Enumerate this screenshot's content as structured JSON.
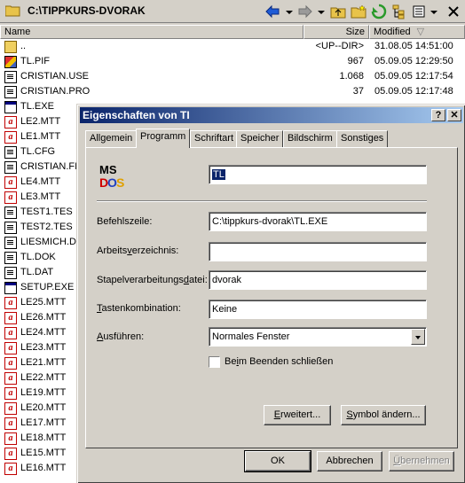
{
  "fm": {
    "path": "C:\\TIPPKURS-DVORAK",
    "columns": {
      "name": "Name",
      "size": "Size",
      "modified": "Modified",
      "sort_glyph": "▽"
    },
    "rows": [
      {
        "name": "..",
        "size": "<UP--DIR>",
        "modified": "31.08.05 14:51:00",
        "icon": "up"
      },
      {
        "name": "TL.PIF",
        "size": "967",
        "modified": "05.09.05 12:29:50",
        "icon": "pif"
      },
      {
        "name": "CRISTIAN.USE",
        "size": "1.068",
        "modified": "05.09.05 12:17:54",
        "icon": "doc"
      },
      {
        "name": "CRISTIAN.PRO",
        "size": "37",
        "modified": "05.09.05 12:17:48",
        "icon": "doc"
      },
      {
        "name": "TL.EXE",
        "size": "",
        "modified": "",
        "icon": "exe"
      },
      {
        "name": "LE2.MTT",
        "size": "",
        "modified": "",
        "icon": "pdf"
      },
      {
        "name": "LE1.MTT",
        "size": "",
        "modified": "",
        "icon": "pdf"
      },
      {
        "name": "TL.CFG",
        "size": "",
        "modified": "",
        "icon": "doc"
      },
      {
        "name": "CRISTIAN.FI",
        "size": "",
        "modified": "",
        "icon": "doc"
      },
      {
        "name": "LE4.MTT",
        "size": "",
        "modified": "",
        "icon": "pdf"
      },
      {
        "name": "LE3.MTT",
        "size": "",
        "modified": "",
        "icon": "pdf"
      },
      {
        "name": "TEST1.TES",
        "size": "",
        "modified": "",
        "icon": "doc"
      },
      {
        "name": "TEST2.TES",
        "size": "",
        "modified": "",
        "icon": "doc"
      },
      {
        "name": "LIESMICH.D",
        "size": "",
        "modified": "",
        "icon": "doc"
      },
      {
        "name": "TL.DOK",
        "size": "",
        "modified": "",
        "icon": "doc"
      },
      {
        "name": "TL.DAT",
        "size": "",
        "modified": "",
        "icon": "doc"
      },
      {
        "name": "SETUP.EXE",
        "size": "",
        "modified": "",
        "icon": "exe"
      },
      {
        "name": "LE25.MTT",
        "size": "",
        "modified": "",
        "icon": "pdf"
      },
      {
        "name": "LE26.MTT",
        "size": "",
        "modified": "",
        "icon": "pdf"
      },
      {
        "name": "LE24.MTT",
        "size": "",
        "modified": "",
        "icon": "pdf"
      },
      {
        "name": "LE23.MTT",
        "size": "",
        "modified": "",
        "icon": "pdf"
      },
      {
        "name": "LE21.MTT",
        "size": "",
        "modified": "",
        "icon": "pdf"
      },
      {
        "name": "LE22.MTT",
        "size": "",
        "modified": "",
        "icon": "pdf"
      },
      {
        "name": "LE19.MTT",
        "size": "",
        "modified": "",
        "icon": "pdf"
      },
      {
        "name": "LE20.MTT",
        "size": "",
        "modified": "",
        "icon": "pdf"
      },
      {
        "name": "LE17.MTT",
        "size": "",
        "modified": "",
        "icon": "pdf"
      },
      {
        "name": "LE18.MTT",
        "size": "",
        "modified": "",
        "icon": "pdf"
      },
      {
        "name": "LE15.MTT",
        "size": "",
        "modified": "",
        "icon": "pdf"
      },
      {
        "name": "LE16.MTT",
        "size": "",
        "modified": "",
        "icon": "pdf"
      }
    ]
  },
  "dialog": {
    "title": "Eigenschaften von TI",
    "help_glyph": "?",
    "close_glyph": "✕",
    "tabs": [
      "Allgemein",
      "Programm",
      "Schriftart",
      "Speicher",
      "Bildschirm",
      "Sonstiges"
    ],
    "active_tab": "Programm",
    "logo_text": "MS DOS",
    "program_name": "TL",
    "labels": {
      "command_line": "Befehlszeile:",
      "workdir_pre": "Arbeits",
      "workdir_u": "v",
      "workdir_post": "erzeichnis:",
      "batch_pre": "Stapelverarbeitungs",
      "batch_u": "d",
      "batch_post": "atei:",
      "hotkey_u": "T",
      "hotkey_post": "astenkombination:",
      "run_u": "A",
      "run_post": "usführen:",
      "close_pre": "Be",
      "close_u": "i",
      "close_post": "m Beenden schließen"
    },
    "values": {
      "command_line": "C:\\tippkurs-dvorak\\TL.EXE",
      "workdir": "",
      "batch": "dvorak",
      "hotkey": "Keine",
      "run": "Normales Fenster"
    },
    "close_on_exit_checked": false,
    "buttons": {
      "advanced_u": "E",
      "advanced_post": "rweitert...",
      "change_icon_u": "S",
      "change_icon_post": "ymbol ändern...",
      "ok": "OK",
      "cancel": "Abbrechen",
      "apply_u": "Ü",
      "apply_post": "bernehmen"
    }
  }
}
